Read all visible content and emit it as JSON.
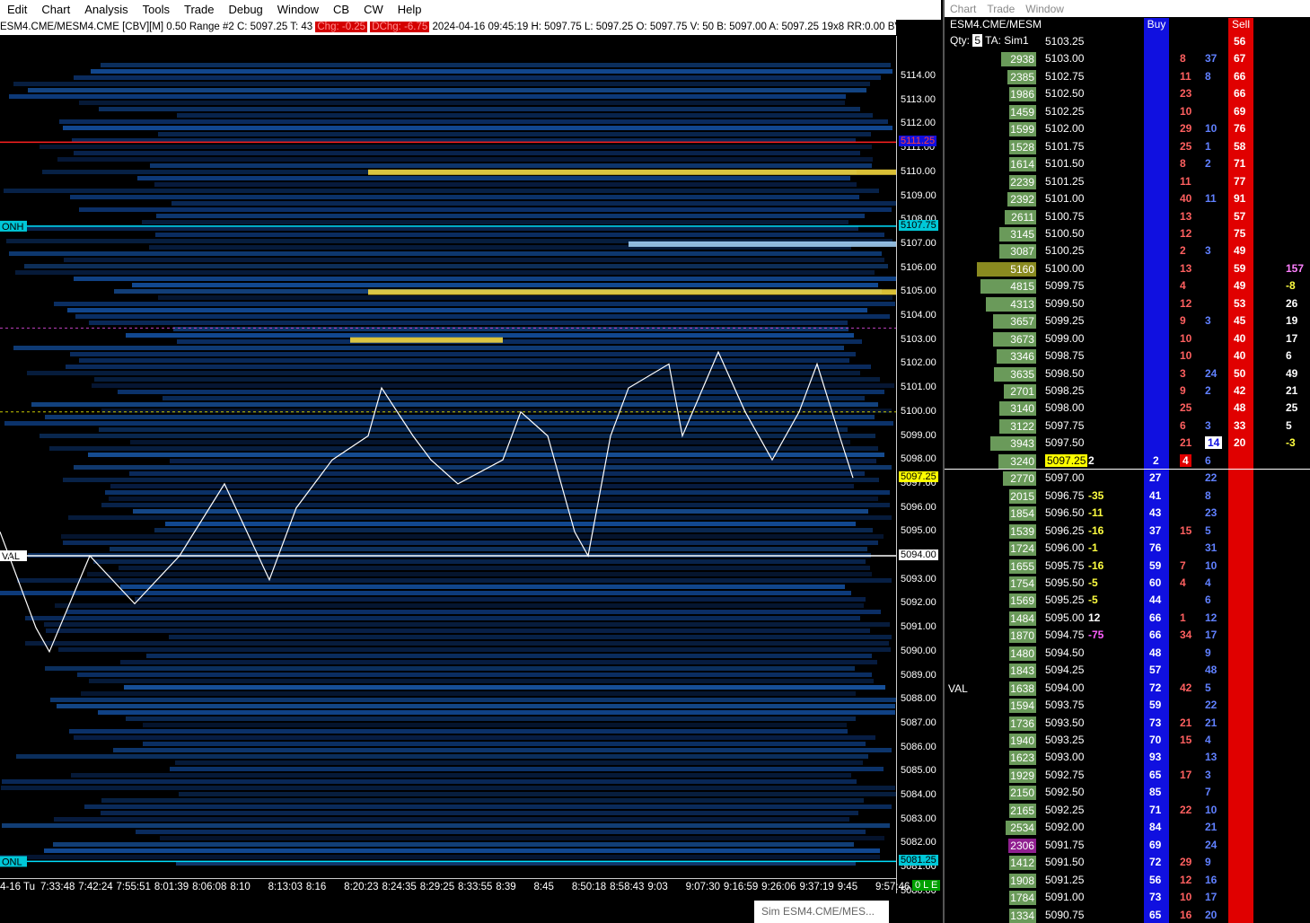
{
  "menu": [
    "Edit",
    "Chart",
    "Analysis",
    "Tools",
    "Trade",
    "Debug",
    "Window",
    "CB",
    "CW",
    "Help"
  ],
  "chart_header": {
    "left": "ESM4.CME/MESM4.CME [CBV][M]  0.50 Range #2",
    "c": "C: 5097.25",
    "t": "T: 43",
    "chg": "Chg: -0.25",
    "dchg": "DChg: -6.75",
    "rest": "2024-04-16 09:45:19 H: 5097.75 L: 5097.25 O: 5097.75 V: 50 B: 5097.00 A: 5097.25 19x8 RR:0.00 BV: 24 A"
  },
  "price_labels": [
    "5114.00",
    "5113.00",
    "5112.00",
    "5111.00",
    "5110.00",
    "5109.00",
    "5108.00",
    "5107.00",
    "5106.00",
    "5105.00",
    "5104.00",
    "5103.00",
    "5102.00",
    "5101.00",
    "5100.00",
    "5099.00",
    "5098.00",
    "5097.00",
    "5096.00",
    "5095.00",
    "5094.00",
    "5093.00",
    "5092.00",
    "5091.00",
    "5090.00",
    "5089.00",
    "5088.00",
    "5087.00",
    "5086.00",
    "5085.00",
    "5084.00",
    "5083.00",
    "5082.00",
    "5081.00",
    "5080.00"
  ],
  "price_tags": {
    "onh": "5107.75",
    "last": "5097.25",
    "val": "5094.00",
    "onl": "5081.25",
    "top": "5111.25"
  },
  "level_labels": {
    "onh": "ONH",
    "val": "VAL",
    "onl": "ONL"
  },
  "time_labels": [
    "4-16 Tu",
    "7:33:48",
    "7:42:24",
    "7:55:51",
    "8:01:39",
    "8:06:08",
    "8:10",
    "8:13:03",
    "8:16",
    "8:20:23",
    "8:24:35",
    "8:29:25",
    "8:33:55",
    "8:39",
    "8:45",
    "8:50:18",
    "8:58:43",
    "9:03",
    "9:07:30",
    "9:16:59",
    "9:26:06",
    "9:37:19",
    "9:45",
    "9:57:46"
  ],
  "ole": "0 L E",
  "dom": {
    "menu": [
      "Chart",
      "Trade",
      "Window"
    ],
    "symbol": "ESM4.CME/MESM",
    "qty_label": "Qty:",
    "qty_value": "5",
    "account": "TA: Sim1",
    "buy_label": "Buy",
    "sell_label": "Sell",
    "val_label": "VAL",
    "rows": [
      {
        "vol": "",
        "price": "5103.25",
        "d": "",
        "b": "",
        "s1": "",
        "s2": "",
        "sell": "56",
        "n": ""
      },
      {
        "vol": "2938",
        "price": "5103.00",
        "d": "",
        "b": "",
        "s1": "8",
        "s2": "37",
        "sell": "67",
        "n": ""
      },
      {
        "vol": "2385",
        "price": "5102.75",
        "d": "",
        "b": "",
        "s1": "11",
        "s2": "8",
        "sell": "66",
        "n": ""
      },
      {
        "vol": "1986",
        "price": "5102.50",
        "d": "",
        "b": "",
        "s1": "23",
        "s2": "",
        "sell": "66",
        "n": ""
      },
      {
        "vol": "1459",
        "price": "5102.25",
        "d": "",
        "b": "",
        "s1": "10",
        "s2": "",
        "sell": "69",
        "n": ""
      },
      {
        "vol": "1599",
        "price": "5102.00",
        "d": "",
        "b": "",
        "s1": "29",
        "s2": "10",
        "sell": "76",
        "n": ""
      },
      {
        "vol": "1528",
        "price": "5101.75",
        "d": "",
        "b": "",
        "s1": "25",
        "s2": "1",
        "sell": "58",
        "n": ""
      },
      {
        "vol": "1614",
        "price": "5101.50",
        "d": "",
        "b": "",
        "s1": "8",
        "s2": "2",
        "sell": "71",
        "n": ""
      },
      {
        "vol": "2239",
        "price": "5101.25",
        "d": "",
        "b": "",
        "s1": "11",
        "s2": "",
        "sell": "77",
        "n": ""
      },
      {
        "vol": "2392",
        "price": "5101.00",
        "d": "",
        "b": "",
        "s1": "40",
        "s2": "11",
        "sell": "91",
        "n": ""
      },
      {
        "vol": "2611",
        "price": "5100.75",
        "d": "",
        "b": "",
        "s1": "13",
        "s2": "",
        "sell": "57",
        "n": ""
      },
      {
        "vol": "3145",
        "price": "5100.50",
        "d": "",
        "b": "",
        "s1": "12",
        "s2": "",
        "sell": "75",
        "n": ""
      },
      {
        "vol": "3087",
        "price": "5100.25",
        "d": "",
        "b": "",
        "s1": "2",
        "s2": "3",
        "sell": "49",
        "n": ""
      },
      {
        "vol": "5160",
        "price": "5100.00",
        "d": "",
        "b": "",
        "s1": "13",
        "s2": "",
        "sell": "59",
        "n": "157"
      },
      {
        "vol": "4815",
        "price": "5099.75",
        "d": "",
        "b": "",
        "s1": "4",
        "s2": "",
        "sell": "49",
        "n": "-8"
      },
      {
        "vol": "4313",
        "price": "5099.50",
        "d": "",
        "b": "",
        "s1": "12",
        "s2": "",
        "sell": "53",
        "n": "26"
      },
      {
        "vol": "3657",
        "price": "5099.25",
        "d": "",
        "b": "",
        "s1": "9",
        "s2": "3",
        "sell": "45",
        "n": "19"
      },
      {
        "vol": "3673",
        "price": "5099.00",
        "d": "",
        "b": "",
        "s1": "10",
        "s2": "",
        "sell": "40",
        "n": "17"
      },
      {
        "vol": "3346",
        "price": "5098.75",
        "d": "",
        "b": "",
        "s1": "10",
        "s2": "",
        "sell": "40",
        "n": "6"
      },
      {
        "vol": "3635",
        "price": "5098.50",
        "d": "",
        "b": "",
        "s1": "3",
        "s2": "24",
        "sell": "50",
        "n": "49"
      },
      {
        "vol": "2701",
        "price": "5098.25",
        "d": "",
        "b": "",
        "s1": "9",
        "s2": "2",
        "sell": "42",
        "n": "21"
      },
      {
        "vol": "3140",
        "price": "5098.00",
        "d": "",
        "b": "",
        "s1": "25",
        "s2": "",
        "sell": "48",
        "n": "25"
      },
      {
        "vol": "3122",
        "price": "5097.75",
        "d": "",
        "b": "",
        "s1": "6",
        "s2": "3",
        "sell": "33",
        "n": "5"
      },
      {
        "vol": "3943",
        "price": "5097.50",
        "d": "",
        "b": "",
        "s1": "21",
        "s2": "14",
        "sell": "20",
        "n": "-3"
      },
      {
        "vol": "3240",
        "price": "5097.25",
        "d": "2",
        "b": "2",
        "s1": "4",
        "s2": "6",
        "sell": "",
        "n": ""
      },
      {
        "vol": "2770",
        "price": "5097.00",
        "d": "",
        "b": "27",
        "s1": "",
        "s2": "22",
        "sell": "",
        "n": ""
      },
      {
        "vol": "2015",
        "price": "5096.75",
        "d": "-35",
        "b": "41",
        "s1": "",
        "s2": "8",
        "sell": "",
        "n": ""
      },
      {
        "vol": "1854",
        "price": "5096.50",
        "d": "-11",
        "b": "43",
        "s1": "",
        "s2": "23",
        "sell": "",
        "n": ""
      },
      {
        "vol": "1539",
        "price": "5096.25",
        "d": "-16",
        "b": "37",
        "s1": "15",
        "s2": "5",
        "sell": "",
        "n": ""
      },
      {
        "vol": "1724",
        "price": "5096.00",
        "d": "-1",
        "b": "76",
        "s1": "",
        "s2": "31",
        "sell": "",
        "n": ""
      },
      {
        "vol": "1655",
        "price": "5095.75",
        "d": "-16",
        "b": "59",
        "s1": "7",
        "s2": "10",
        "sell": "",
        "n": ""
      },
      {
        "vol": "1754",
        "price": "5095.50",
        "d": "-5",
        "b": "60",
        "s1": "4",
        "s2": "4",
        "sell": "",
        "n": ""
      },
      {
        "vol": "1569",
        "price": "5095.25",
        "d": "-5",
        "b": "44",
        "s1": "",
        "s2": "6",
        "sell": "",
        "n": ""
      },
      {
        "vol": "1484",
        "price": "5095.00",
        "d": "12",
        "b": "66",
        "s1": "1",
        "s2": "12",
        "sell": "",
        "n": ""
      },
      {
        "vol": "1870",
        "price": "5094.75",
        "d": "-75",
        "b": "66",
        "s1": "34",
        "s2": "17",
        "sell": "",
        "n": ""
      },
      {
        "vol": "1480",
        "price": "5094.50",
        "d": "",
        "b": "48",
        "s1": "",
        "s2": "9",
        "sell": "",
        "n": ""
      },
      {
        "vol": "1843",
        "price": "5094.25",
        "d": "",
        "b": "57",
        "s1": "",
        "s2": "48",
        "sell": "",
        "n": ""
      },
      {
        "vol": "1638",
        "price": "5094.00",
        "d": "",
        "b": "72",
        "s1": "42",
        "s2": "5",
        "sell": "",
        "n": ""
      },
      {
        "vol": "1594",
        "price": "5093.75",
        "d": "",
        "b": "59",
        "s1": "",
        "s2": "22",
        "sell": "",
        "n": ""
      },
      {
        "vol": "1736",
        "price": "5093.50",
        "d": "",
        "b": "73",
        "s1": "21",
        "s2": "21",
        "sell": "",
        "n": ""
      },
      {
        "vol": "1940",
        "price": "5093.25",
        "d": "",
        "b": "70",
        "s1": "15",
        "s2": "4",
        "sell": "",
        "n": ""
      },
      {
        "vol": "1623",
        "price": "5093.00",
        "d": "",
        "b": "93",
        "s1": "",
        "s2": "13",
        "sell": "",
        "n": ""
      },
      {
        "vol": "1929",
        "price": "5092.75",
        "d": "",
        "b": "65",
        "s1": "17",
        "s2": "3",
        "sell": "",
        "n": ""
      },
      {
        "vol": "2150",
        "price": "5092.50",
        "d": "",
        "b": "85",
        "s1": "",
        "s2": "7",
        "sell": "",
        "n": ""
      },
      {
        "vol": "2165",
        "price": "5092.25",
        "d": "",
        "b": "71",
        "s1": "22",
        "s2": "10",
        "sell": "",
        "n": ""
      },
      {
        "vol": "2534",
        "price": "5092.00",
        "d": "",
        "b": "84",
        "s1": "",
        "s2": "21",
        "sell": "",
        "n": ""
      },
      {
        "vol": "2306",
        "price": "5091.75",
        "d": "",
        "b": "69",
        "s1": "",
        "s2": "24",
        "sell": "",
        "n": ""
      },
      {
        "vol": "1412",
        "price": "5091.50",
        "d": "",
        "b": "72",
        "s1": "29",
        "s2": "9",
        "sell": "",
        "n": ""
      },
      {
        "vol": "1908",
        "price": "5091.25",
        "d": "",
        "b": "56",
        "s1": "12",
        "s2": "16",
        "sell": "",
        "n": ""
      },
      {
        "vol": "1784",
        "price": "5091.00",
        "d": "",
        "b": "73",
        "s1": "10",
        "s2": "17",
        "sell": "",
        "n": ""
      },
      {
        "vol": "1334",
        "price": "5090.75",
        "d": "",
        "b": "65",
        "s1": "16",
        "s2": "20",
        "sell": "",
        "n": ""
      }
    ]
  },
  "toast": "Sim ESM4.CME/MES...",
  "colors": {
    "buy": "#1010e0",
    "sell": "#e00000",
    "vol": "#6a9a5a",
    "poc": "#8a8a20",
    "last": "#ffff00"
  }
}
